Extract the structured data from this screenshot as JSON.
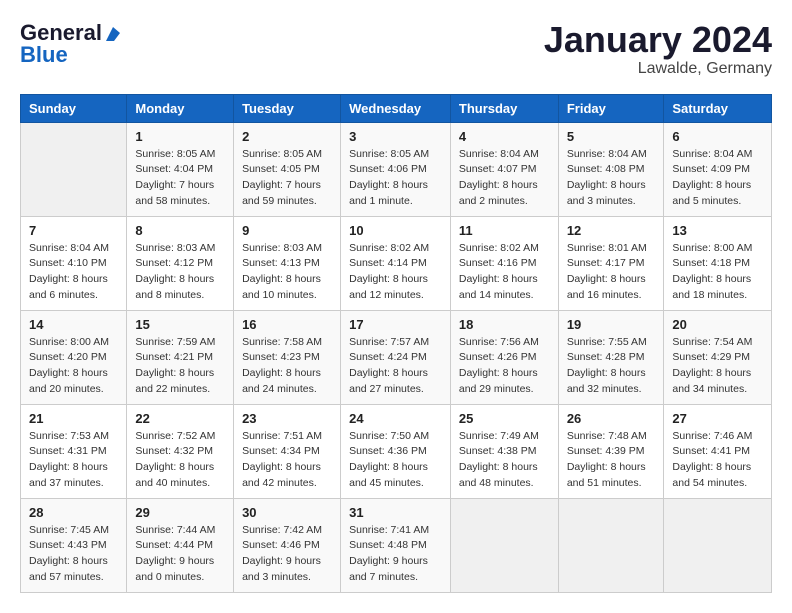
{
  "header": {
    "logo_line1": "General",
    "logo_line2": "Blue",
    "month": "January 2024",
    "location": "Lawalde, Germany"
  },
  "weekdays": [
    "Sunday",
    "Monday",
    "Tuesday",
    "Wednesday",
    "Thursday",
    "Friday",
    "Saturday"
  ],
  "weeks": [
    [
      {
        "day": "",
        "info": ""
      },
      {
        "day": "1",
        "info": "Sunrise: 8:05 AM\nSunset: 4:04 PM\nDaylight: 7 hours\nand 58 minutes."
      },
      {
        "day": "2",
        "info": "Sunrise: 8:05 AM\nSunset: 4:05 PM\nDaylight: 7 hours\nand 59 minutes."
      },
      {
        "day": "3",
        "info": "Sunrise: 8:05 AM\nSunset: 4:06 PM\nDaylight: 8 hours\nand 1 minute."
      },
      {
        "day": "4",
        "info": "Sunrise: 8:04 AM\nSunset: 4:07 PM\nDaylight: 8 hours\nand 2 minutes."
      },
      {
        "day": "5",
        "info": "Sunrise: 8:04 AM\nSunset: 4:08 PM\nDaylight: 8 hours\nand 3 minutes."
      },
      {
        "day": "6",
        "info": "Sunrise: 8:04 AM\nSunset: 4:09 PM\nDaylight: 8 hours\nand 5 minutes."
      }
    ],
    [
      {
        "day": "7",
        "info": "Sunrise: 8:04 AM\nSunset: 4:10 PM\nDaylight: 8 hours\nand 6 minutes."
      },
      {
        "day": "8",
        "info": "Sunrise: 8:03 AM\nSunset: 4:12 PM\nDaylight: 8 hours\nand 8 minutes."
      },
      {
        "day": "9",
        "info": "Sunrise: 8:03 AM\nSunset: 4:13 PM\nDaylight: 8 hours\nand 10 minutes."
      },
      {
        "day": "10",
        "info": "Sunrise: 8:02 AM\nSunset: 4:14 PM\nDaylight: 8 hours\nand 12 minutes."
      },
      {
        "day": "11",
        "info": "Sunrise: 8:02 AM\nSunset: 4:16 PM\nDaylight: 8 hours\nand 14 minutes."
      },
      {
        "day": "12",
        "info": "Sunrise: 8:01 AM\nSunset: 4:17 PM\nDaylight: 8 hours\nand 16 minutes."
      },
      {
        "day": "13",
        "info": "Sunrise: 8:00 AM\nSunset: 4:18 PM\nDaylight: 8 hours\nand 18 minutes."
      }
    ],
    [
      {
        "day": "14",
        "info": "Sunrise: 8:00 AM\nSunset: 4:20 PM\nDaylight: 8 hours\nand 20 minutes."
      },
      {
        "day": "15",
        "info": "Sunrise: 7:59 AM\nSunset: 4:21 PM\nDaylight: 8 hours\nand 22 minutes."
      },
      {
        "day": "16",
        "info": "Sunrise: 7:58 AM\nSunset: 4:23 PM\nDaylight: 8 hours\nand 24 minutes."
      },
      {
        "day": "17",
        "info": "Sunrise: 7:57 AM\nSunset: 4:24 PM\nDaylight: 8 hours\nand 27 minutes."
      },
      {
        "day": "18",
        "info": "Sunrise: 7:56 AM\nSunset: 4:26 PM\nDaylight: 8 hours\nand 29 minutes."
      },
      {
        "day": "19",
        "info": "Sunrise: 7:55 AM\nSunset: 4:28 PM\nDaylight: 8 hours\nand 32 minutes."
      },
      {
        "day": "20",
        "info": "Sunrise: 7:54 AM\nSunset: 4:29 PM\nDaylight: 8 hours\nand 34 minutes."
      }
    ],
    [
      {
        "day": "21",
        "info": "Sunrise: 7:53 AM\nSunset: 4:31 PM\nDaylight: 8 hours\nand 37 minutes."
      },
      {
        "day": "22",
        "info": "Sunrise: 7:52 AM\nSunset: 4:32 PM\nDaylight: 8 hours\nand 40 minutes."
      },
      {
        "day": "23",
        "info": "Sunrise: 7:51 AM\nSunset: 4:34 PM\nDaylight: 8 hours\nand 42 minutes."
      },
      {
        "day": "24",
        "info": "Sunrise: 7:50 AM\nSunset: 4:36 PM\nDaylight: 8 hours\nand 45 minutes."
      },
      {
        "day": "25",
        "info": "Sunrise: 7:49 AM\nSunset: 4:38 PM\nDaylight: 8 hours\nand 48 minutes."
      },
      {
        "day": "26",
        "info": "Sunrise: 7:48 AM\nSunset: 4:39 PM\nDaylight: 8 hours\nand 51 minutes."
      },
      {
        "day": "27",
        "info": "Sunrise: 7:46 AM\nSunset: 4:41 PM\nDaylight: 8 hours\nand 54 minutes."
      }
    ],
    [
      {
        "day": "28",
        "info": "Sunrise: 7:45 AM\nSunset: 4:43 PM\nDaylight: 8 hours\nand 57 minutes."
      },
      {
        "day": "29",
        "info": "Sunrise: 7:44 AM\nSunset: 4:44 PM\nDaylight: 9 hours\nand 0 minutes."
      },
      {
        "day": "30",
        "info": "Sunrise: 7:42 AM\nSunset: 4:46 PM\nDaylight: 9 hours\nand 3 minutes."
      },
      {
        "day": "31",
        "info": "Sunrise: 7:41 AM\nSunset: 4:48 PM\nDaylight: 9 hours\nand 7 minutes."
      },
      {
        "day": "",
        "info": ""
      },
      {
        "day": "",
        "info": ""
      },
      {
        "day": "",
        "info": ""
      }
    ]
  ]
}
